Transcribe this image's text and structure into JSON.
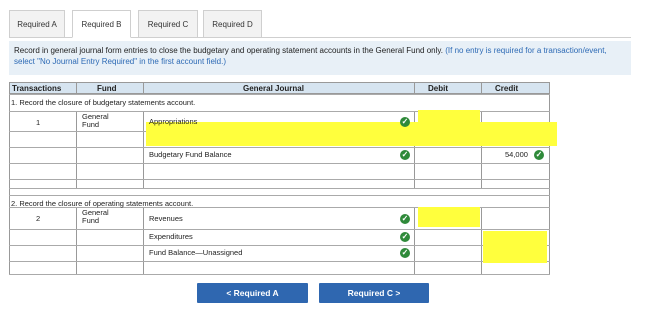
{
  "tabs": [
    "Required A",
    "Required B",
    "Required C",
    "Required D"
  ],
  "instruction": {
    "main": "Record in general journal form entries to close the budgetary and operating statement accounts in the General Fund only.",
    "note": "(If no entry is required for a transaction/event, select \"No Journal Entry Required\" in the first account field.)"
  },
  "table": {
    "headers": [
      "Transactions",
      "Fund",
      "General Journal",
      "Debit",
      "Credit"
    ],
    "section1": {
      "title": "1. Record the closure of budgetary statements account.",
      "transaction": "1",
      "fund": "General Fund",
      "rows": [
        {
          "account": "Appropriations",
          "debit": "",
          "credit": ""
        },
        {
          "account": "",
          "debit": "",
          "credit": ""
        },
        {
          "account": "Budgetary Fund Balance",
          "debit": "",
          "credit": "54,000"
        },
        {
          "account": "",
          "debit": "",
          "credit": ""
        }
      ]
    },
    "section2": {
      "title": "2. Record the closure of operating statements account.",
      "transaction": "2",
      "fund": "General Fund",
      "rows": [
        {
          "account": "Revenues",
          "debit": "",
          "credit": ""
        },
        {
          "account": "Expenditures",
          "debit": "",
          "credit": ""
        },
        {
          "account": "Fund Balance—Unassigned",
          "debit": "",
          "credit": ""
        }
      ]
    }
  },
  "nav": {
    "prev": "< Required A",
    "next": "Required C >"
  },
  "colors": {
    "accent": "#2f67b0",
    "highlight": "#ffff3d",
    "check": "#2f8a3a",
    "header_bg": "#d6e4f0"
  },
  "icons": {
    "check": "check-circle-icon"
  }
}
